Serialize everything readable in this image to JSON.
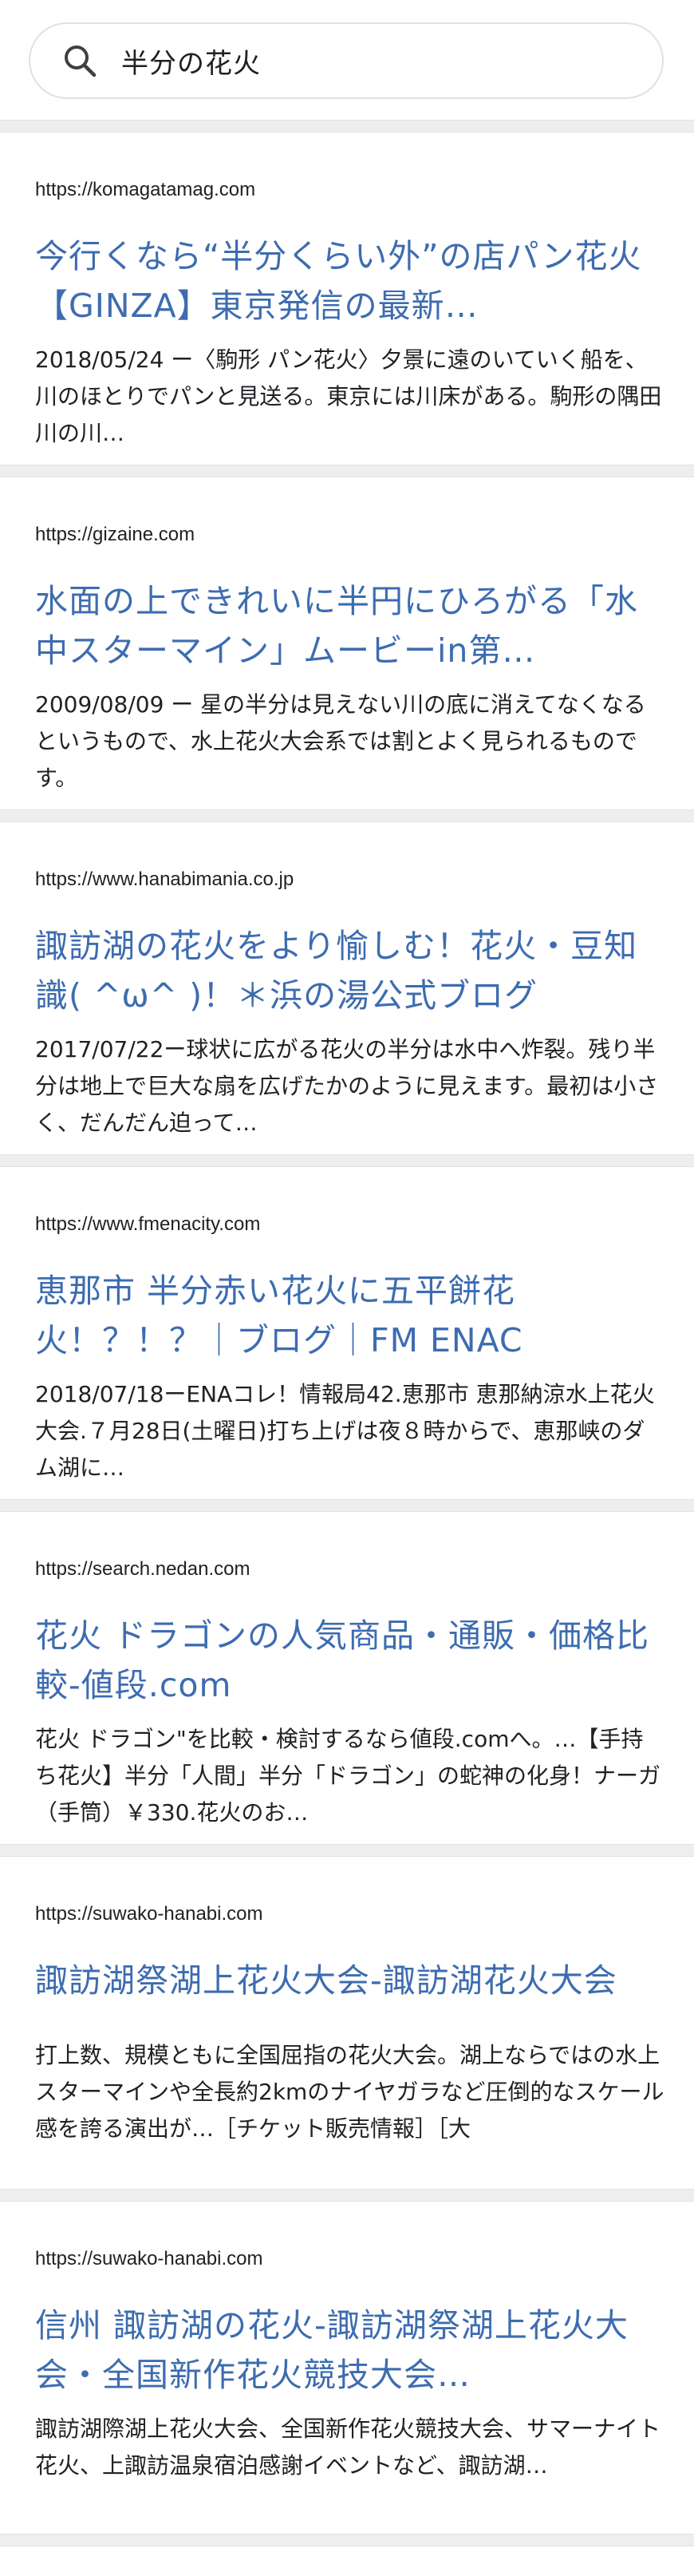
{
  "search": {
    "query": "半分の花火"
  },
  "results": [
    {
      "url": "https://komagatamag.com",
      "title": "今行くなら“半分くらい外”の店パン花火【GINZA】東京発信の最新…",
      "snippet": "2018/05/24 ー〈駒形 パン花火〉夕景に遠のいていく船を、川のほとりでパンと見送る。東京には川床がある。駒形の隅田川の川…"
    },
    {
      "url": "https://gizaine.com",
      "title": "水面の上できれいに半円にひろがる「水中スターマイン」ムービーin第…",
      "snippet": "2009/08/09 ー 星の半分は見えない川の底に消えてなくなるというもので、水上花火大会系では割とよく見られるものです。"
    },
    {
      "url": "https://www.hanabimania.co.jp",
      "title": "諏訪湖の花火をより愉しむ！花火・豆知識( ^ω^ )！＊浜の湯公式ブログ",
      "snippet": "2017/07/22ー球状に広がる花火の半分は水中へ炸裂。残り半分は地上で巨大な扇を広げたかのように見えます。最初は小さく、だんだん迫って…"
    },
    {
      "url": "https://www.fmenacity.com",
      "title": "恵那市 半分赤い花火に五平餅花火！？！？｜ブログ｜FM ENAC",
      "snippet": "2018/07/18ーENAコレ！情報局42.恵那市 恵那納涼水上花火大会.７月28日(土曜日)打ち上げは夜８時からで、恵那峡のダム湖に…"
    },
    {
      "url": "https://search.nedan.com",
      "title": "花火 ドラゴンの人気商品・通販・価格比較-値段.com",
      "snippet": "花火 ドラゴン\"を比較・検討するなら値段.comへ。…【手持ち花火】半分「人間」半分「ドラゴン」の蛇神の化身！ナーガ（手筒）￥330.花火のお…"
    },
    {
      "url": "https://suwako-hanabi.com",
      "title": "諏訪湖祭湖上花火大会-諏訪湖花火大会",
      "snippet": "打上数、規模ともに全国屈指の花火大会。湖上ならではの水上スターマインや全長約2kmのナイヤガラなど圧倒的なスケール感を誇る演出が…［チケット販売情報］［大"
    },
    {
      "url": "https://suwako-hanabi.com",
      "title": "信州 諏訪湖の花火-諏訪湖祭湖上花火大会・全国新作花火競技大会…",
      "snippet": "諏訪湖際湖上花火大会、全国新作花火競技大会、サマーナイト花火、上諏訪温泉宿泊感謝イベントなど、諏訪湖…"
    }
  ]
}
